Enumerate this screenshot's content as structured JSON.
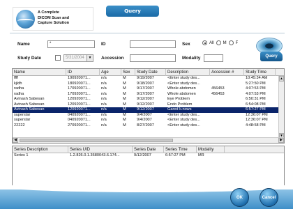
{
  "logo": {
    "text_line1": "A Complete",
    "text_line2": "DICOM Scan and",
    "text_line3": "Capture Solution"
  },
  "title": "Query",
  "form": {
    "name_label": "Name",
    "name_value": "*",
    "id_label": "ID",
    "id_value": "",
    "sex_label": "Sex",
    "sex_options": [
      "All",
      "M",
      "F"
    ],
    "sex_selected": "All",
    "study_date_label": "Study Date",
    "study_date_value": "5/31/2004",
    "accession_label": "Accession",
    "accession_value": "",
    "modality_label": "Modality",
    "modality_value": "",
    "query_label": "Query"
  },
  "studies": {
    "columns": [
      "Name",
      "ID",
      "Age",
      "Sex",
      "Study Date",
      "Description",
      "Accession #",
      "Study Time"
    ],
    "rows": [
      [
        "ffff",
        "190920071...",
        "n/a",
        "M",
        "9/19/2007",
        "<Enter study des...",
        "",
        "10:45:34 AM"
      ],
      [
        "kjldh",
        "180920071...",
        "n/a",
        "M",
        "9/18/2007",
        "<Enter study des...",
        "",
        "5:27:50 PM"
      ],
      [
        "radha",
        "170920071...",
        "n/a",
        "M",
        "9/17/2007",
        "Whole abdomen",
        "456453",
        "4:07:53 PM"
      ],
      [
        "radha",
        "170920071...",
        "n/a",
        "M",
        "9/17/2007",
        "Whole abdomen",
        "456453",
        "4:07:53 PM"
      ],
      [
        "Avinash Sabesan",
        "120920071...",
        "n/a",
        "M",
        "9/12/2007",
        "Eye Problem",
        "",
        "6:50:31 PM"
      ],
      [
        "Avinash Sabesan",
        "120920071...",
        "n/a",
        "M",
        "9/12/2007",
        "Endo Problem",
        "",
        "6:54:08 PM"
      ],
      [
        "Avinash Sabesan",
        "120920071...",
        "n/a",
        "M",
        "9/12/2007",
        "Gared k.nows",
        "",
        "6:57:27 PM"
      ],
      [
        "superstar",
        "040920071...",
        "n/a",
        "M",
        "9/4/2007",
        "<Enter study des...",
        "",
        "12:36:07 PM"
      ],
      [
        "superstar",
        "040920071...",
        "n/a",
        "M",
        "9/4/2007",
        "<Enter study des...",
        "",
        "12:36:07 PM"
      ],
      [
        "22222",
        "270920071...",
        "n/a",
        "M",
        "8/27/2007",
        "<Enter study des...",
        "",
        "4:48:58 PM"
      ]
    ],
    "selected_index": 6
  },
  "series": {
    "columns": [
      "Series Description",
      "Series UID",
      "Series Date",
      "Series Time",
      "Modality"
    ],
    "rows": [
      [
        "Series 1",
        "1.2.826.0.1.3680043.6.174...",
        "9/12/2007",
        "6:57:27 PM",
        "MR"
      ]
    ]
  },
  "buttons": {
    "ok": "OK",
    "cancel": "Cancel"
  },
  "colors": {
    "accent": "#1a6aa6",
    "selection": "#0a246a",
    "footer": "#3f8fc8"
  }
}
